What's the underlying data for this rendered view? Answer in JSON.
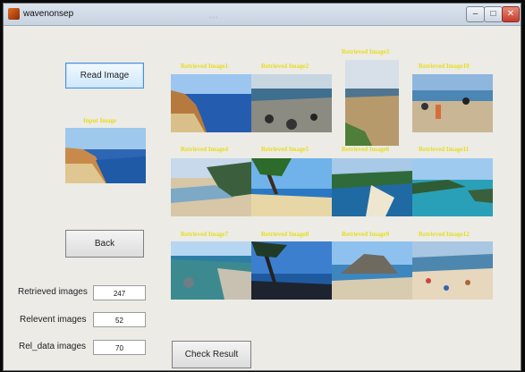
{
  "window": {
    "title": "wavenonsep",
    "blurred_title": "...",
    "controls": {
      "minimize": "–",
      "maximize": "□",
      "close": "✕"
    }
  },
  "buttons": {
    "read_image": "Read Image",
    "back": "Back",
    "check_result": "Check Result"
  },
  "input_caption": "Input Image",
  "retrieved_captions": [
    "Retrieved Image1",
    "Retrieved Image2",
    "Retrieved Image3",
    "Retrieved Image10",
    "Retrieved Image4",
    "Retrieved Image5",
    "Retrieved Image6",
    "Retrieved Image11",
    "Retrieved Image7",
    "Retrieved Image8",
    "Retrieved Image9",
    "Retrieved Image12"
  ],
  "stats": {
    "retrieved_label": "Retrieved images",
    "retrieved_value": "247",
    "relevant_label": "Relevent images",
    "relevant_value": "52",
    "rel_data_label": "Rel_data images",
    "rel_data_value": "70"
  },
  "icons": [
    "app-icon"
  ]
}
